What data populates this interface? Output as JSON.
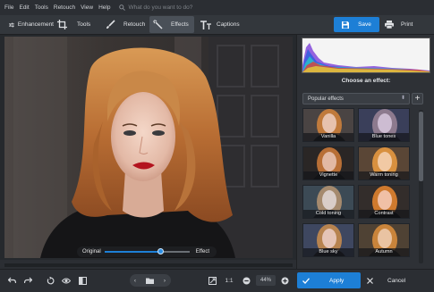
{
  "menu": {
    "items": [
      "File",
      "Edit",
      "Tools",
      "Retouch",
      "View",
      "Help"
    ],
    "search_placeholder": "What do you want to do?"
  },
  "toolbar": {
    "tabs": [
      {
        "label": "Enhancement",
        "icon": "sliders-icon"
      },
      {
        "label": "Tools",
        "icon": "crop-icon"
      },
      {
        "label": "Retouch",
        "icon": "brush-icon"
      },
      {
        "label": "Effects",
        "icon": "magic-wand-icon",
        "active": true
      },
      {
        "label": "Captions",
        "icon": "text-icon"
      }
    ],
    "save_label": "Save",
    "print_label": "Print"
  },
  "canvas": {
    "slider": {
      "left_label": "Original",
      "right_label": "Effect",
      "value": 0.66
    }
  },
  "panel": {
    "choose_title": "Choose an effect:",
    "dropdown_value": "Popular effects",
    "effects": [
      "Vanilla",
      "Blue tones",
      "Vignette",
      "Warm toning",
      "Cold toning",
      "Contrast",
      "Blue sky",
      "Autumn"
    ]
  },
  "bottom": {
    "zoom_ratio": "1:1",
    "zoom_value": "44%",
    "apply_label": "Apply",
    "cancel_label": "Cancel"
  },
  "colors": {
    "accent": "#1d7fd6",
    "background": "#2b2e33"
  }
}
